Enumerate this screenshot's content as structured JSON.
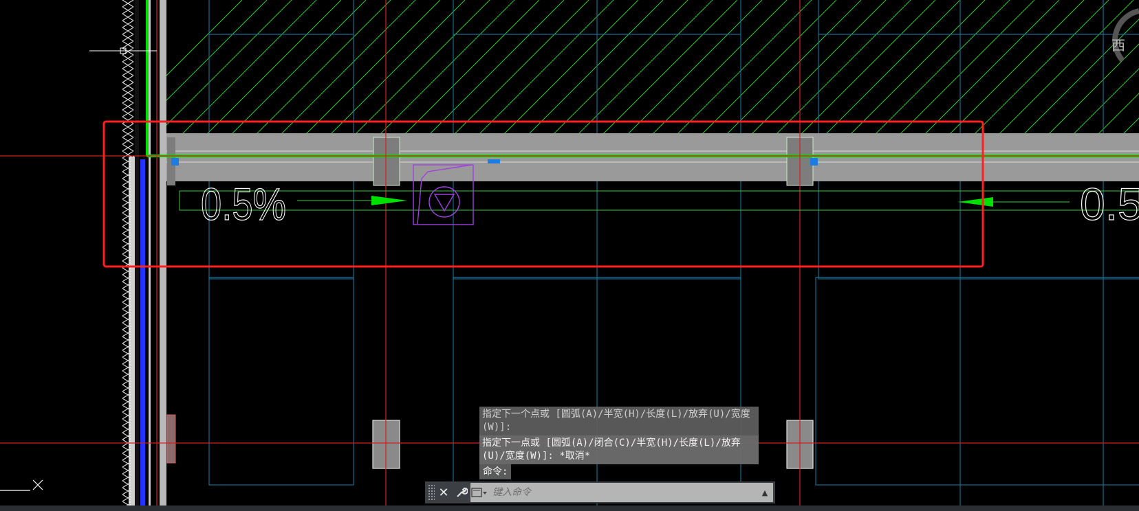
{
  "drawing": {
    "slope_left": "0.5%",
    "slope_right": "0.5",
    "compass_label": "西"
  },
  "command_history": [
    "指定下一个点或 [圆弧(A)/半宽(H)/长度(L)/放弃(U)/宽度(W)]:",
    "指定下一点或 [圆弧(A)/闭合(C)/半宽(H)/长度(L)/放弃(U)/宽度(W)]: *取消*"
  ],
  "command_prompt": "命令:",
  "command_line": {
    "placeholder": "键入命令",
    "close_icon": "close-icon",
    "customize_icon": "wrench-icon",
    "recent_icon": "command-prompt-icon",
    "expand_icon": "chevron-up-icon"
  },
  "colors": {
    "background": "#000000",
    "hatch": "#33cc33",
    "gridline": "#1b6b8e",
    "axis_red": "#d42020",
    "wall_green": "#00e000",
    "highlight_box": "#ff2020",
    "drain_symbol": "#a040e0",
    "grip": "#1e7be0"
  }
}
